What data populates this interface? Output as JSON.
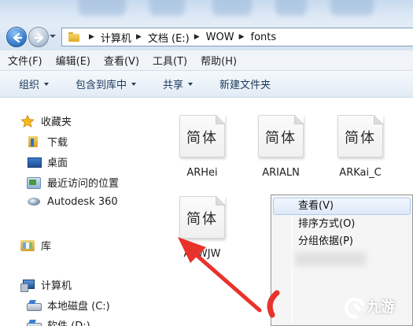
{
  "address_bar": {
    "crumbs": [
      "计算机",
      "文档 (E:)",
      "WOW",
      "fonts"
    ]
  },
  "menubar": {
    "items": [
      "文件(F)",
      "编辑(E)",
      "查看(V)",
      "工具(T)",
      "帮助(H)"
    ]
  },
  "toolbar": {
    "organize": "组织",
    "include_in_library": "包含到库中",
    "share": "共享",
    "new_folder": "新建文件夹"
  },
  "nav": {
    "favorites": "收藏夹",
    "downloads": "下载",
    "desktop": "桌面",
    "recent": "最近访问的位置",
    "autodesk": "Autodesk 360",
    "libraries": "库",
    "computer": "计算机",
    "local_disk": "本地磁盘 (C:)",
    "software_disk": "软件 (D:)"
  },
  "files": [
    {
      "glyph": "简体",
      "name": "ARHei"
    },
    {
      "glyph": "简体",
      "name": "ARIALN"
    },
    {
      "glyph": "简体",
      "name": "ARKai_C"
    },
    {
      "glyph": "简体",
      "name": "ARWJW"
    }
  ],
  "context_menu": {
    "items": [
      "查看(V)",
      "排序方式(O)",
      "分组依据(P)"
    ]
  },
  "watermark": {
    "text": "九游"
  },
  "colors": {
    "annotation_arrow": "#e8332c",
    "menu_highlight": "#dde9f8"
  }
}
